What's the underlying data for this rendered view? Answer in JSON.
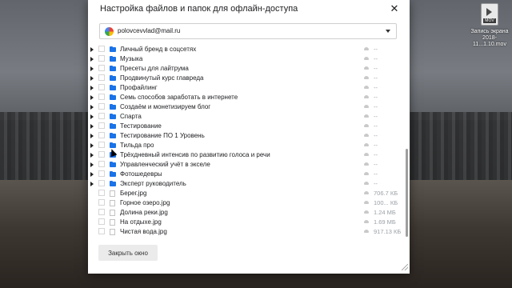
{
  "desktop": {
    "file_icon_label": "MOV",
    "file_name": "Запись экрана 2018-11...1.10.mov"
  },
  "dialog": {
    "title": "Настройка файлов и папок для офлайн-доступа",
    "account_email": "polovcevvlad@mail.ru",
    "close_button_label": "Закрыть окно"
  },
  "items": [
    {
      "type": "folder",
      "name": "Личный бренд в соцсетях",
      "size": "--"
    },
    {
      "type": "folder",
      "name": "Музыка",
      "size": "--"
    },
    {
      "type": "folder",
      "name": "Пресеты для лайтрума",
      "size": "--"
    },
    {
      "type": "folder",
      "name": "Продвинутый курс главреда",
      "size": "--"
    },
    {
      "type": "folder",
      "name": "Профайлинг",
      "size": "--"
    },
    {
      "type": "folder",
      "name": "Семь способов заработать в интернете",
      "size": "--"
    },
    {
      "type": "folder",
      "name": "Создаём и монетизируем блог",
      "size": "--"
    },
    {
      "type": "folder",
      "name": "Спарта",
      "size": "--"
    },
    {
      "type": "folder",
      "name": "Тестирование",
      "size": "--"
    },
    {
      "type": "folder",
      "name": "Тестирование ПО 1 Уровень",
      "size": "--"
    },
    {
      "type": "folder",
      "name": "Тильда про",
      "size": "--"
    },
    {
      "type": "folder",
      "name": "Трёхдневный интенсив по развитию голоса и речи",
      "size": "--"
    },
    {
      "type": "folder",
      "name": "Управленческий учёт в экселе",
      "size": "--"
    },
    {
      "type": "folder",
      "name": "Фотошедевры",
      "size": "--"
    },
    {
      "type": "folder",
      "name": "Эксперт руководитель",
      "size": "--"
    },
    {
      "type": "file",
      "name": "Берег.jpg",
      "size": "706.7 КБ"
    },
    {
      "type": "file",
      "name": "Горное озеро.jpg",
      "size": "100... КБ"
    },
    {
      "type": "file",
      "name": "Долина реки.jpg",
      "size": "1.24 МБ"
    },
    {
      "type": "file",
      "name": "На отдыхе.jpg",
      "size": "1.69 МБ"
    },
    {
      "type": "file",
      "name": "Чистая вода.jpg",
      "size": "917.13 КБ"
    }
  ],
  "colors": {
    "folder": "#1a73e8",
    "size_text": "#9aa0a6"
  }
}
